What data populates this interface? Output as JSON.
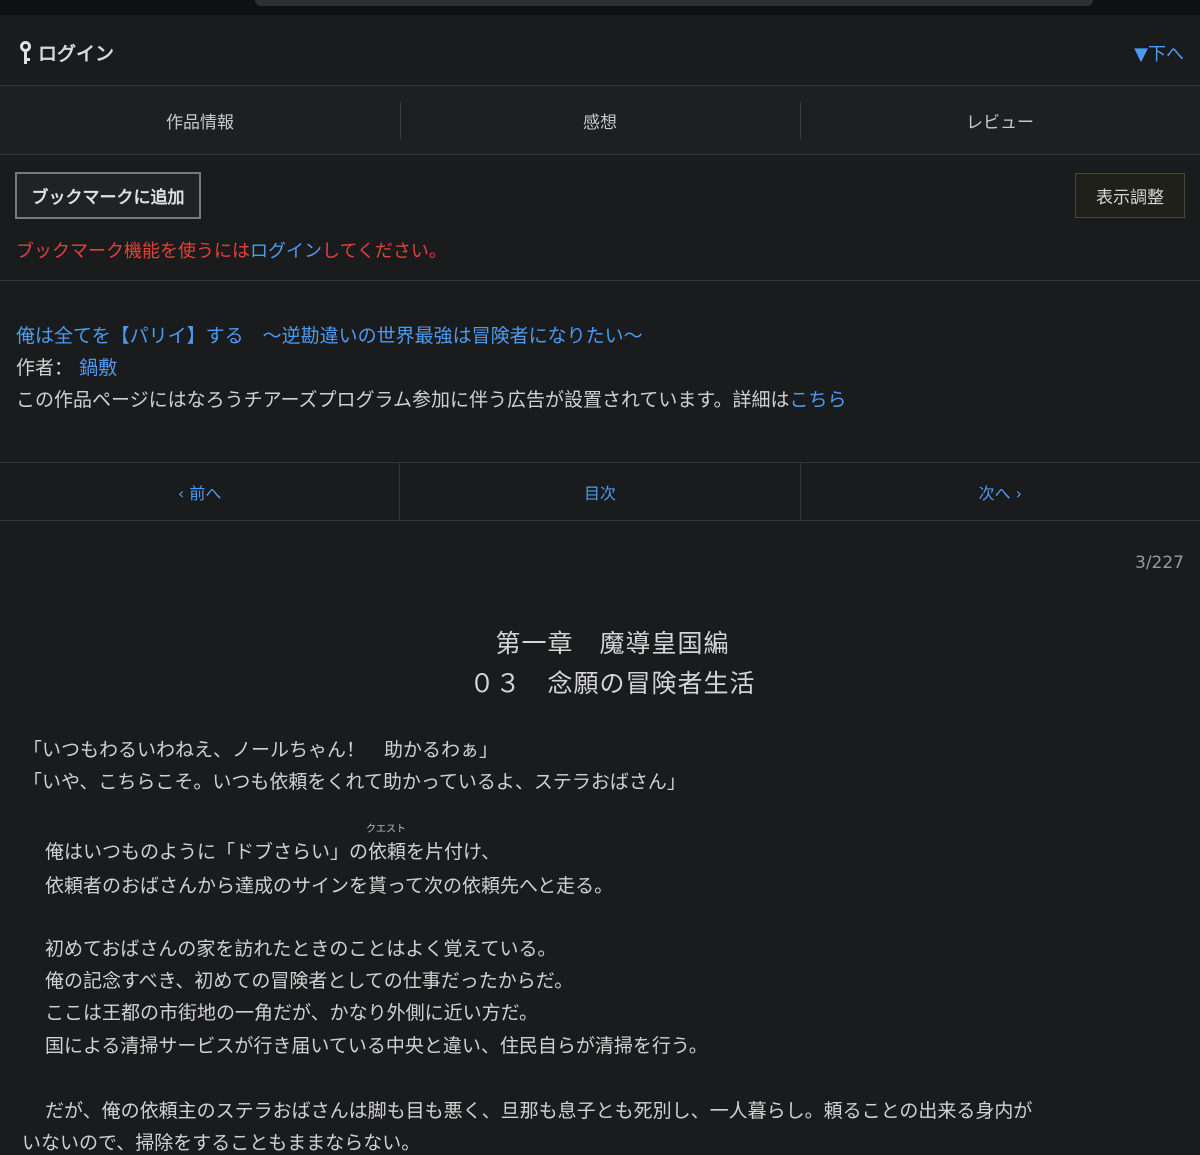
{
  "header": {
    "login_label": "ログイン",
    "down_label": "▼下へ"
  },
  "tabs": [
    "作品情報",
    "感想",
    "レビュー"
  ],
  "bookmark": {
    "add_label": "ブックマークに追加",
    "display_settings_label": "表示調整",
    "notice_prefix": "ブックマーク機能を使うには",
    "notice_link": "ログイン",
    "notice_suffix": "してください。"
  },
  "work": {
    "title": "俺は全てを【パリイ】する　〜逆勘違いの世界最強は冒険者になりたい〜",
    "author_label": "作者：",
    "author_name": "鍋敷",
    "ad_notice": "この作品ページにはなろうチアーズプログラム参加に伴う広告が設置されています。詳細は",
    "ad_link": "こちら"
  },
  "pager": {
    "prev": "‹ 前へ",
    "toc": "目次",
    "next": "次へ ›"
  },
  "episode": {
    "page_counter": "3/227",
    "chapter_title": "第一章　魔導皇国編",
    "episode_title": "０３　念願の冒険者生活"
  },
  "body": {
    "line1": "「いつもわるいわねえ、ノールちゃん！　助かるわぁ」",
    "line2": "「いや、こちらこそ。いつも依頼をくれて助かっているよ、ステラおばさん」",
    "line3_pre": "　俺はいつものように「ドブさらい」の",
    "line3_ruby_base": "依頼",
    "line3_ruby_text": "クエスト",
    "line3_post": "を片付け、",
    "line4": "　依頼者のおばさんから達成のサインを貰って次の依頼先へと走る。",
    "line5": "　初めておばさんの家を訪れたときのことはよく覚えている。",
    "line6": "　俺の記念すべき、初めての冒険者としての仕事だったからだ。",
    "line7": "　ここは王都の市街地の一角だが、かなり外側に近い方だ。",
    "line8": "　国による清掃サービスが行き届いている中央と違い、住民自らが清掃を行う。",
    "line9": "　だが、俺の依頼主のステラおばさんは脚も目も悪く、旦那も息子とも死別し、一人暮らし。頼ることの出来る身内が",
    "line10": "いないので、掃除をすることもままならない。"
  }
}
